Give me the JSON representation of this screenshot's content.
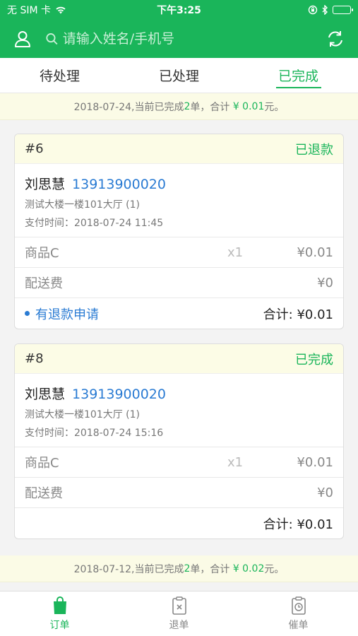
{
  "status_bar": {
    "carrier": "无 SIM 卡",
    "time": "下午3:25"
  },
  "header": {
    "search_placeholder": "请输入姓名/手机号"
  },
  "tabs": [
    {
      "label": "待处理",
      "active": false
    },
    {
      "label": "已处理",
      "active": false
    },
    {
      "label": "已完成",
      "active": true
    }
  ],
  "summary1": {
    "prefix": "2018-07-24,当前已完成",
    "count": "2",
    "mid": "单，合计",
    "amount": "¥ 0.01",
    "suffix": "元。"
  },
  "orders": [
    {
      "no": "#6",
      "status": "已退款",
      "name": "刘思慧",
      "phone": "13913900020",
      "address": "测试大楼一楼101大厅 (1)",
      "pay_time": "支付时间：2018-07-24 11:45",
      "item_name": "商品C",
      "item_qty": "x1",
      "item_price": "¥0.01",
      "delivery_label": "配送费",
      "delivery_price": "¥0",
      "refund_text": "有退款申请",
      "total": "合计: ¥0.01"
    },
    {
      "no": "#8",
      "status": "已完成",
      "name": "刘思慧",
      "phone": "13913900020",
      "address": "测试大楼一楼101大厅 (1)",
      "pay_time": "支付时间：2018-07-24 15:16",
      "item_name": "商品C",
      "item_qty": "x1",
      "item_price": "¥0.01",
      "delivery_label": "配送费",
      "delivery_price": "¥0",
      "total": "合计: ¥0.01"
    }
  ],
  "summary2": {
    "prefix": "2018-07-12,当前已完成",
    "count": "2",
    "mid": "单，合计",
    "amount": "¥ 0.02",
    "suffix": "元。"
  },
  "tabbar": [
    {
      "label": "订单",
      "icon": "order-bag-icon",
      "active": true
    },
    {
      "label": "退单",
      "icon": "refund-clipboard-icon",
      "active": false
    },
    {
      "label": "催单",
      "icon": "urge-clock-icon",
      "active": false
    }
  ],
  "colors": {
    "brand": "#1ab55a",
    "link": "#2a7bd3",
    "summary_bg": "#fbfbe6"
  }
}
